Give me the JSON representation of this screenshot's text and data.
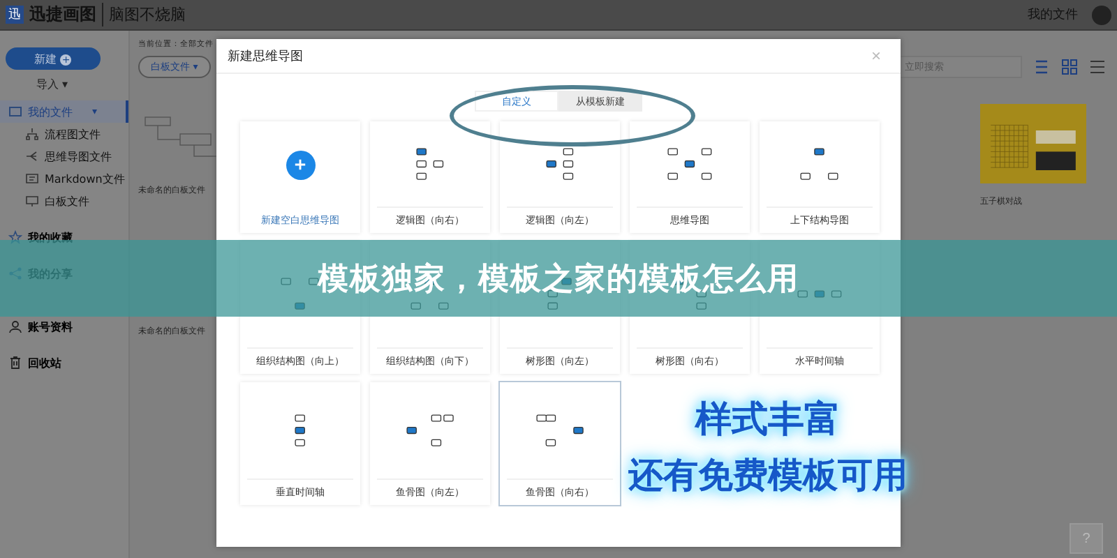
{
  "top_bar": {
    "logo_mark": "迅",
    "logo": "迅捷画图",
    "slogan": "脑图不烧脑",
    "files_link": "我的文件"
  },
  "sidebar": {
    "new_button": "新建",
    "new_icon": "+",
    "import": "导入",
    "import_caret": "▾",
    "items": [
      {
        "label": "我的文件",
        "kind": "folder",
        "selected": true,
        "expanded": true,
        "caret": "▾",
        "children": [
          {
            "label": "流程图文件",
            "kind": "flow",
            "selected": false
          },
          {
            "label": "思维导图文件",
            "kind": "mind",
            "selected": false
          },
          {
            "label": "Markdown文件",
            "kind": "markdown",
            "selected": false
          },
          {
            "label": "白板文件",
            "kind": "board",
            "selected": false
          }
        ]
      },
      {
        "label": "我的收藏",
        "kind": "star",
        "selected": false
      },
      {
        "label": "我的分享",
        "kind": "share",
        "selected": false
      }
    ],
    "bottom_items": [
      {
        "label": "账号资料",
        "kind": "user"
      },
      {
        "label": "回收站",
        "kind": "trash"
      }
    ]
  },
  "content": {
    "breadcrumb": "当前位置：全部文件",
    "filter": "白板文件",
    "filter_caret": "▾",
    "search": {
      "placeholder": "立即搜索"
    },
    "files_left": [
      {
        "name": "未命名的白板文件",
        "kind": "flowchart"
      },
      {
        "name": "未命名的白板文件",
        "kind": "blank"
      }
    ],
    "files_right": [
      {
        "name": "五子棋对战",
        "kind": "board"
      }
    ],
    "help": "?"
  },
  "dialog": {
    "title": "新建思维导图",
    "close": "×",
    "tabs": [
      {
        "label": "自定义",
        "selected": true
      },
      {
        "label": "从模板新建",
        "selected": false
      }
    ],
    "cards": [
      {
        "label": "新建空白思维导图",
        "kind": "new",
        "selected": false
      },
      {
        "label": "逻辑图（向右）",
        "kind": "right",
        "selected": false
      },
      {
        "label": "逻辑图（向左）",
        "kind": "left",
        "selected": false
      },
      {
        "label": "思维导图",
        "kind": "both",
        "selected": false
      },
      {
        "label": "上下结构导图",
        "kind": "down",
        "selected": false
      },
      {
        "label": "组织结构图（向上）",
        "kind": "up",
        "selected": false
      },
      {
        "label": "组织结构图（向下）",
        "kind": "down",
        "selected": false
      },
      {
        "label": "树形图（向左）",
        "kind": "treeleft",
        "selected": false
      },
      {
        "label": "树形图（向右）",
        "kind": "treeright",
        "selected": false
      },
      {
        "label": "水平时间轴",
        "kind": "htime",
        "selected": false
      },
      {
        "label": "垂直时间轴",
        "kind": "vtime",
        "selected": false
      },
      {
        "label": "鱼骨图（向左）",
        "kind": "fishleft",
        "selected": false
      },
      {
        "label": "鱼骨图（向右）",
        "kind": "fishright",
        "selected": true
      }
    ]
  },
  "banner": {
    "title": "模板独家，模板之家的模板怎么用"
  },
  "promo": {
    "lines": [
      "样式丰富",
      "还有免费模板可用"
    ]
  }
}
